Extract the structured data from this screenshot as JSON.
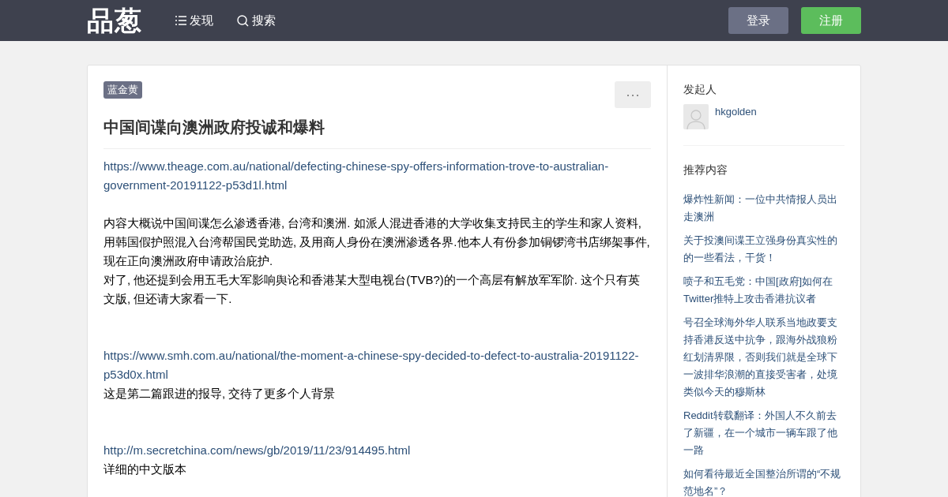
{
  "header": {
    "logo": "品葱",
    "nav": [
      {
        "kind": "list",
        "label": "发现"
      },
      {
        "kind": "search",
        "label": "搜索"
      }
    ],
    "login": "登录",
    "register": "注册"
  },
  "post": {
    "tag": "蓝金黄",
    "title": "中国间谍向澳洲政府投诚和爆料",
    "more": "⋯",
    "sections": [
      {
        "items": [
          {
            "kind": "link",
            "text": "https://www.theage.com.au/national/defecting-chinese-spy-offers-information-trove-to-australian-government-20191122-p53d1l.html"
          }
        ]
      },
      {
        "items": [
          {
            "kind": "text",
            "text": "内容大概说中国间谍怎么渗透香港, 台湾和澳洲. 如派人混进香港的大学收集支持民主的学生和家人资料, 用韩国假护照混入台湾帮国民党助选, 及用商人身份在澳洲渗透各界.他本人有份参加铜锣湾书店绑架事件, 现在正向澳洲政府申请政治庇护."
          },
          {
            "kind": "text",
            "text": "对了, 他还提到会用五毛大军影响舆论和香港某大型电视台(TVB?)的一个高层有解放军军阶. 这个只有英文版, 但还请大家看一下."
          }
        ]
      },
      {
        "items": [
          {
            "kind": "link",
            "text": "https://www.smh.com.au/national/the-moment-a-chinese-spy-decided-to-defect-to-australia-20191122-p53d0x.html"
          },
          {
            "kind": "text",
            "text": "这是第二篇跟进的报导, 交待了更多个人背景"
          }
        ]
      },
      {
        "items": [
          {
            "kind": "link",
            "text": "http://m.secretchina.com/news/gb/2019/11/23/914495.html"
          },
          {
            "kind": "text",
            "text": "详细的中文版本"
          }
        ]
      }
    ]
  },
  "sidebar": {
    "initiator_heading": "发起人",
    "user": "hkgolden",
    "recommend_heading": "推荐内容",
    "recommended": [
      "爆炸性新闻：一位中共情报人员出走澳洲",
      "关于投澳间谍王立强身份真实性的的一些看法，干货！",
      "喷子和五毛党：中国[政府]如何在Twitter推特上攻击香港抗议者",
      "号召全球海外华人联系当地政要支持香港反送中抗争，跟海外战狼粉红划清界限，否则我们就是全球下一波排华浪潮的直接受害者，处境类似今天的穆斯林",
      "Reddit转载翻译：外国人不久前去了新疆，在一个城市一辆车跟了他一路",
      "如何看待最近全国整治所谓的“不规范地名”？"
    ]
  }
}
